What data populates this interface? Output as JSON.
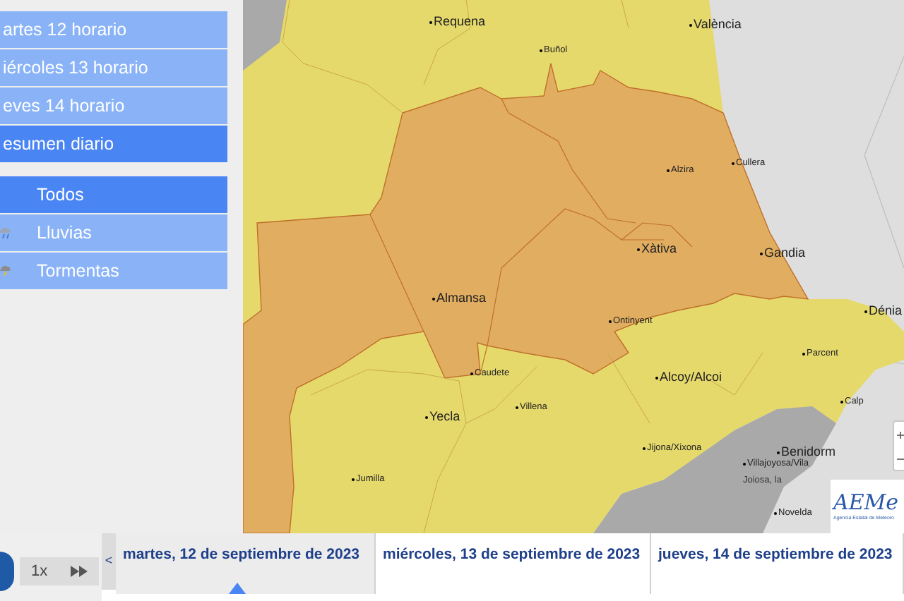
{
  "sidebar": {
    "days": [
      {
        "label": "artes 12 horario",
        "selected": false
      },
      {
        "label": "iércoles 13 horario",
        "selected": false
      },
      {
        "label": "eves 14 horario",
        "selected": false
      },
      {
        "label": "esumen diario",
        "selected": true
      }
    ],
    "filters": [
      {
        "label": "Todos",
        "selected": true,
        "kind": "none"
      },
      {
        "label": "Lluvias",
        "selected": false,
        "kind": "rain"
      },
      {
        "label": "Tormentas",
        "selected": false,
        "kind": "storm"
      }
    ]
  },
  "map": {
    "places": [
      {
        "name": "Requena",
        "kind": "city"
      },
      {
        "name": "València",
        "kind": "city"
      },
      {
        "name": "Buñol",
        "kind": "town"
      },
      {
        "name": "Alzira",
        "kind": "town"
      },
      {
        "name": "Cullera",
        "kind": "town"
      },
      {
        "name": "Xàtiva",
        "kind": "city"
      },
      {
        "name": "Gandia",
        "kind": "city"
      },
      {
        "name": "Almansa",
        "kind": "city"
      },
      {
        "name": "Ontinyent",
        "kind": "town"
      },
      {
        "name": "Dénia",
        "kind": "city"
      },
      {
        "name": "Parcent",
        "kind": "town"
      },
      {
        "name": "Caudete",
        "kind": "town"
      },
      {
        "name": "Alcoy/Alcoi",
        "kind": "city"
      },
      {
        "name": "Calp",
        "kind": "town"
      },
      {
        "name": "Villena",
        "kind": "town"
      },
      {
        "name": "Yecla",
        "kind": "city"
      },
      {
        "name": "Benidorm",
        "kind": "city"
      },
      {
        "name": "Jijona/Xixona",
        "kind": "town"
      },
      {
        "name": "Villajoyosa/Vila",
        "kind": "town"
      },
      {
        "name": "Joiosa, la",
        "kind": "continuation"
      },
      {
        "name": "Jumilla",
        "kind": "town"
      },
      {
        "name": "Novelda",
        "kind": "town"
      }
    ],
    "logo": {
      "mark": "AEMe",
      "subtitle": "Agencia Estatal de Meteoro"
    }
  },
  "player": {
    "speed": "1x"
  },
  "timeline": {
    "prev": "<",
    "days": [
      {
        "label": "martes, 12 de septiembre de 2023",
        "selected": true
      },
      {
        "label": "miércoles, 13 de septiembre de 2023",
        "selected": false
      },
      {
        "label": "jueves, 14 de septiembre de 2023",
        "selected": false
      }
    ]
  }
}
